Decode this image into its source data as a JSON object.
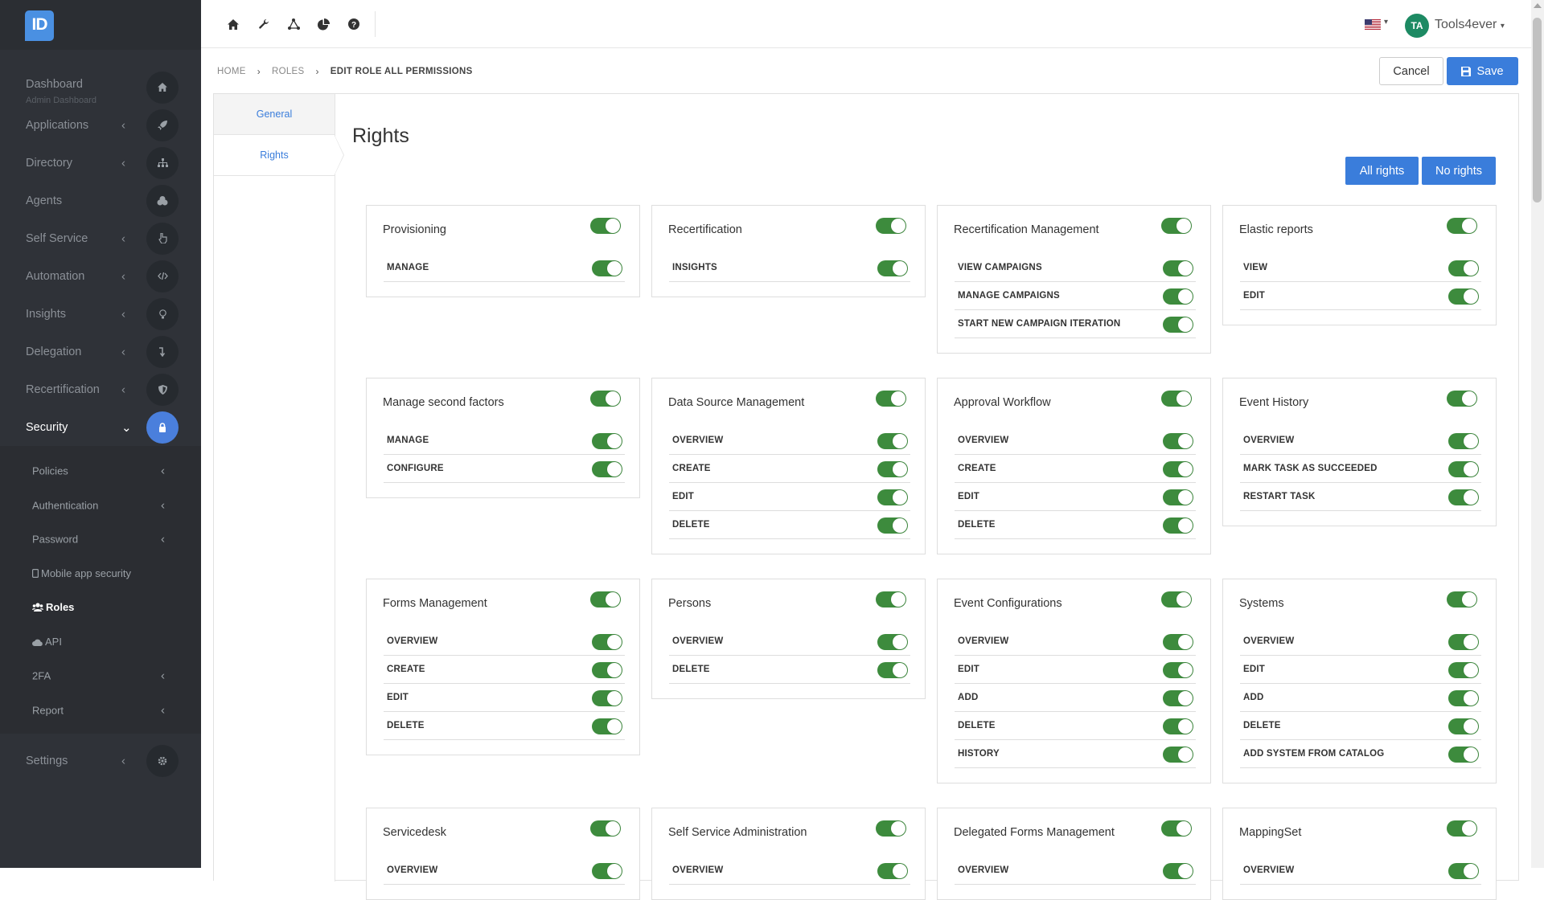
{
  "app": {
    "logo_text": "ID"
  },
  "sidebar": {
    "items": [
      {
        "key": "dashboard",
        "label": "Dashboard",
        "sublabel": "Admin Dashboard",
        "icon": "home-icon",
        "chevron": false
      },
      {
        "key": "applications",
        "label": "Applications",
        "icon": "rocket-icon",
        "chevron": true
      },
      {
        "key": "directory",
        "label": "Directory",
        "icon": "sitemap-icon",
        "chevron": true
      },
      {
        "key": "agents",
        "label": "Agents",
        "icon": "cubes-icon",
        "chevron": false
      },
      {
        "key": "self-service",
        "label": "Self Service",
        "icon": "hand-pointer-icon",
        "chevron": true
      },
      {
        "key": "automation",
        "label": "Automation",
        "icon": "code-icon",
        "chevron": true
      },
      {
        "key": "insights",
        "label": "Insights",
        "icon": "lightbulb-icon",
        "chevron": true
      },
      {
        "key": "delegation",
        "label": "Delegation",
        "icon": "level-down-icon",
        "chevron": true
      },
      {
        "key": "recertification",
        "label": "Recertification",
        "icon": "shield-icon",
        "chevron": true
      },
      {
        "key": "security",
        "label": "Security",
        "icon": "lock-icon",
        "chevron": true,
        "active": true
      }
    ],
    "security_sub": [
      {
        "key": "policies",
        "label": "Policies",
        "chevron": true
      },
      {
        "key": "authentication",
        "label": "Authentication",
        "chevron": true
      },
      {
        "key": "password",
        "label": "Password",
        "chevron": true
      },
      {
        "key": "mobile-app-security",
        "label": "Mobile app security",
        "icon": "mobile-icon",
        "chevron": false
      },
      {
        "key": "roles",
        "label": "Roles",
        "icon": "users-icon",
        "chevron": false,
        "active": true
      },
      {
        "key": "api",
        "label": "API",
        "icon": "cloud-icon",
        "chevron": false
      },
      {
        "key": "2fa",
        "label": "2FA",
        "chevron": true
      },
      {
        "key": "report",
        "label": "Report",
        "chevron": true
      }
    ],
    "settings": {
      "label": "Settings",
      "icon": "gear-icon"
    }
  },
  "topbar": {
    "icons": [
      "home-icon",
      "wrench-icon",
      "share-nodes-icon",
      "pie-chart-icon",
      "help-circle-icon"
    ],
    "language_flag": "us-flag-icon",
    "user_initials": "TA",
    "user_name": "Tools4ever"
  },
  "breadcrumb": {
    "home": "HOME",
    "roles": "ROLES",
    "current": "EDIT ROLE ALL PERMISSIONS"
  },
  "actions": {
    "cancel_label": "Cancel",
    "save_label": "Save"
  },
  "tabs": {
    "general": "General",
    "rights": "Rights"
  },
  "rights": {
    "title": "Rights",
    "all_label": "All rights",
    "none_label": "No rights",
    "toggle_on_color": "#3d8b3d",
    "cards": [
      {
        "title": "Provisioning",
        "enabled": true,
        "perms": [
          {
            "label": "MANAGE",
            "on": true
          }
        ]
      },
      {
        "title": "Recertification",
        "enabled": true,
        "perms": [
          {
            "label": "INSIGHTS",
            "on": true
          }
        ]
      },
      {
        "title": "Recertification Management",
        "enabled": true,
        "perms": [
          {
            "label": "VIEW CAMPAIGNS",
            "on": true
          },
          {
            "label": "MANAGE CAMPAIGNS",
            "on": true
          },
          {
            "label": "START NEW CAMPAIGN ITERATION",
            "on": true
          }
        ]
      },
      {
        "title": "Elastic reports",
        "enabled": true,
        "perms": [
          {
            "label": "VIEW",
            "on": true
          },
          {
            "label": "EDIT",
            "on": true
          }
        ]
      },
      {
        "title": "Manage second factors",
        "enabled": true,
        "perms": [
          {
            "label": "MANAGE",
            "on": true
          },
          {
            "label": "CONFIGURE",
            "on": true
          }
        ]
      },
      {
        "title": "Data Source Management",
        "enabled": true,
        "perms": [
          {
            "label": "OVERVIEW",
            "on": true
          },
          {
            "label": "CREATE",
            "on": true
          },
          {
            "label": "EDIT",
            "on": true
          },
          {
            "label": "DELETE",
            "on": true
          }
        ]
      },
      {
        "title": "Approval Workflow",
        "enabled": true,
        "perms": [
          {
            "label": "OVERVIEW",
            "on": true
          },
          {
            "label": "CREATE",
            "on": true
          },
          {
            "label": "EDIT",
            "on": true
          },
          {
            "label": "DELETE",
            "on": true
          }
        ]
      },
      {
        "title": "Event History",
        "enabled": true,
        "perms": [
          {
            "label": "OVERVIEW",
            "on": true
          },
          {
            "label": "MARK TASK AS SUCCEEDED",
            "on": true
          },
          {
            "label": "RESTART TASK",
            "on": true
          }
        ]
      },
      {
        "title": "Forms Management",
        "enabled": true,
        "perms": [
          {
            "label": "OVERVIEW",
            "on": true
          },
          {
            "label": "CREATE",
            "on": true
          },
          {
            "label": "EDIT",
            "on": true
          },
          {
            "label": "DELETE",
            "on": true
          }
        ]
      },
      {
        "title": "Persons",
        "enabled": true,
        "perms": [
          {
            "label": "OVERVIEW",
            "on": true
          },
          {
            "label": "DELETE",
            "on": true
          }
        ]
      },
      {
        "title": "Event Configurations",
        "enabled": true,
        "perms": [
          {
            "label": "OVERVIEW",
            "on": true
          },
          {
            "label": "EDIT",
            "on": true
          },
          {
            "label": "ADD",
            "on": true
          },
          {
            "label": "DELETE",
            "on": true
          },
          {
            "label": "HISTORY",
            "on": true
          }
        ]
      },
      {
        "title": "Systems",
        "enabled": true,
        "perms": [
          {
            "label": "OVERVIEW",
            "on": true
          },
          {
            "label": "EDIT",
            "on": true
          },
          {
            "label": "ADD",
            "on": true
          },
          {
            "label": "DELETE",
            "on": true
          },
          {
            "label": "ADD SYSTEM FROM CATALOG",
            "on": true
          }
        ]
      },
      {
        "title": "Servicedesk",
        "enabled": true,
        "perms": [
          {
            "label": "OVERVIEW",
            "on": true
          }
        ]
      },
      {
        "title": "Self Service Administration",
        "enabled": true,
        "perms": [
          {
            "label": "OVERVIEW",
            "on": true
          }
        ]
      },
      {
        "title": "Delegated Forms Management",
        "enabled": true,
        "perms": [
          {
            "label": "OVERVIEW",
            "on": true
          }
        ]
      },
      {
        "title": "MappingSet",
        "enabled": true,
        "perms": [
          {
            "label": "OVERVIEW",
            "on": true
          }
        ]
      }
    ]
  }
}
